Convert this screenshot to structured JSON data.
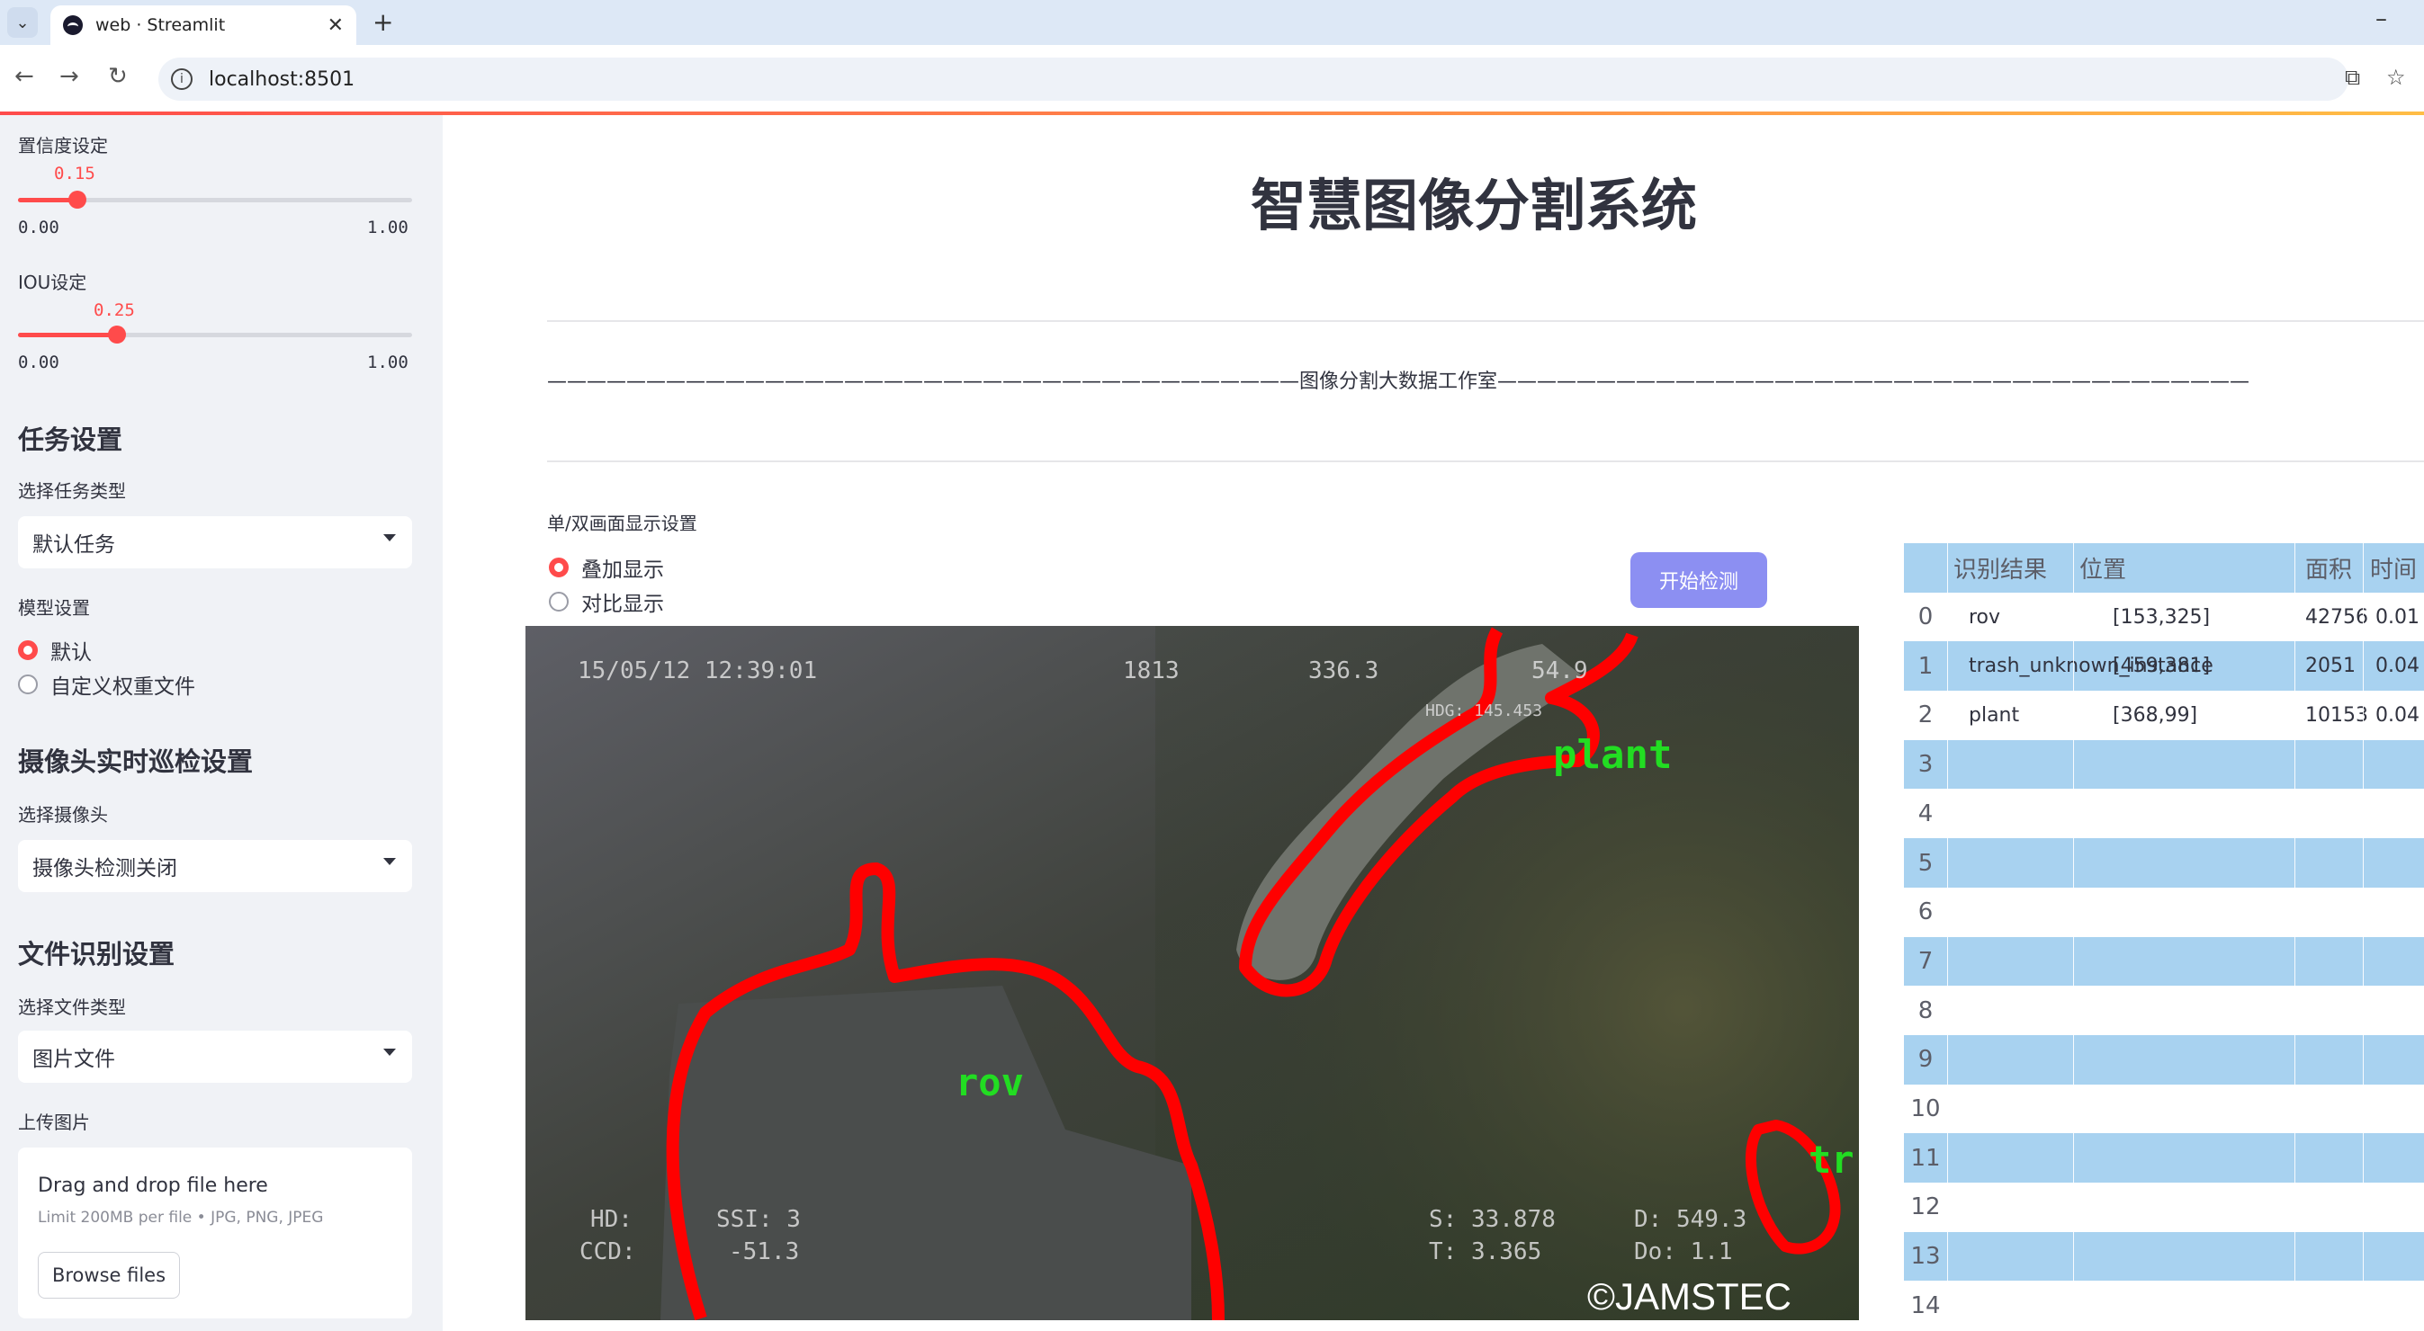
{
  "browser": {
    "tab_title": "web · Streamlit",
    "url": "localhost:8501"
  },
  "sidebar": {
    "confidence": {
      "label": "置信度设定",
      "value": 0.15,
      "value_text": "0.15",
      "min": "0.00",
      "max": "1.00"
    },
    "iou": {
      "label": "IOU设定",
      "value": 0.25,
      "value_text": "0.25",
      "min": "0.00",
      "max": "1.00"
    },
    "task_section": {
      "heading": "任务设置",
      "task_type_label": "选择任务类型",
      "task_type_value": "默认任务"
    },
    "model": {
      "label": "模型设置",
      "options": [
        "默认",
        "自定义权重文件"
      ],
      "selected": 0
    },
    "camera_section": {
      "heading": "摄像头实时巡检设置",
      "camera_label": "选择摄像头",
      "camera_value": "摄像头检测关闭"
    },
    "file_section": {
      "heading": "文件识别设置",
      "file_type_label": "选择文件类型",
      "file_type_value": "图片文件",
      "upload_label": "上传图片"
    },
    "uploader": {
      "title": "Drag and drop file here",
      "subtitle": "Limit 200MB per file • JPG, PNG, JPEG",
      "button": "Browse files"
    }
  },
  "main": {
    "title": "智慧图像分割系统",
    "banner": "——————————————————————————————————————图像分割大数据工作室——————————————————————————————————————",
    "display_mode_label": "单/双画面显示设置",
    "display_options": [
      "叠加显示",
      "对比显示"
    ],
    "display_selected": 0,
    "start_button": "开始检测"
  },
  "image": {
    "overlay_text": {
      "timestamp": "15/05/12  12:39:01",
      "code": "1813",
      "heading_val": "336.3",
      "hdg_label": "HDG: 145.453",
      "pitch": "54.9",
      "hd_label": "HD:",
      "ssi": "SSI: 3",
      "ccd_label": "CCD:",
      "ccd_val": "-51.3",
      "s_val": "S: 33.878",
      "t_val": "T: 3.365",
      "d_val": "D: 549.3",
      "do_val": "Do: 1.1",
      "copyright": "©JAMSTEC"
    },
    "labels": [
      "plant",
      "rov",
      "tr"
    ]
  },
  "results_table": {
    "columns": [
      "识别结果",
      "位置",
      "面积",
      "时间"
    ],
    "rows": [
      {
        "idx": "0",
        "result": "rov",
        "position": "[153,325]",
        "area": "42756",
        "time": "0.01"
      },
      {
        "idx": "1",
        "result": "trash_unknown_instance",
        "position": "[459,381]",
        "area": "2051",
        "time": "0.04"
      },
      {
        "idx": "2",
        "result": "plant",
        "position": "[368,99]",
        "area": "10153",
        "time": "0.04"
      },
      {
        "idx": "3",
        "result": "",
        "position": "",
        "area": "",
        "time": ""
      },
      {
        "idx": "4",
        "result": "",
        "position": "",
        "area": "",
        "time": ""
      },
      {
        "idx": "5",
        "result": "",
        "position": "",
        "area": "",
        "time": ""
      },
      {
        "idx": "6",
        "result": "",
        "position": "",
        "area": "",
        "time": ""
      },
      {
        "idx": "7",
        "result": "",
        "position": "",
        "area": "",
        "time": ""
      },
      {
        "idx": "8",
        "result": "",
        "position": "",
        "area": "",
        "time": ""
      },
      {
        "idx": "9",
        "result": "",
        "position": "",
        "area": "",
        "time": ""
      },
      {
        "idx": "10",
        "result": "",
        "position": "",
        "area": "",
        "time": ""
      },
      {
        "idx": "11",
        "result": "",
        "position": "",
        "area": "",
        "time": ""
      },
      {
        "idx": "12",
        "result": "",
        "position": "",
        "area": "",
        "time": ""
      },
      {
        "idx": "13",
        "result": "",
        "position": "",
        "area": "",
        "time": ""
      },
      {
        "idx": "14",
        "result": "",
        "position": "",
        "area": "",
        "time": ""
      }
    ]
  },
  "colors": {
    "accent": "#ff4b4b",
    "sidebar_bg": "#f0f2f6",
    "table_stripe": "#a8d2f0",
    "button": "#8c8ff2",
    "mask": "#ff0000",
    "label": "#22dd22"
  }
}
